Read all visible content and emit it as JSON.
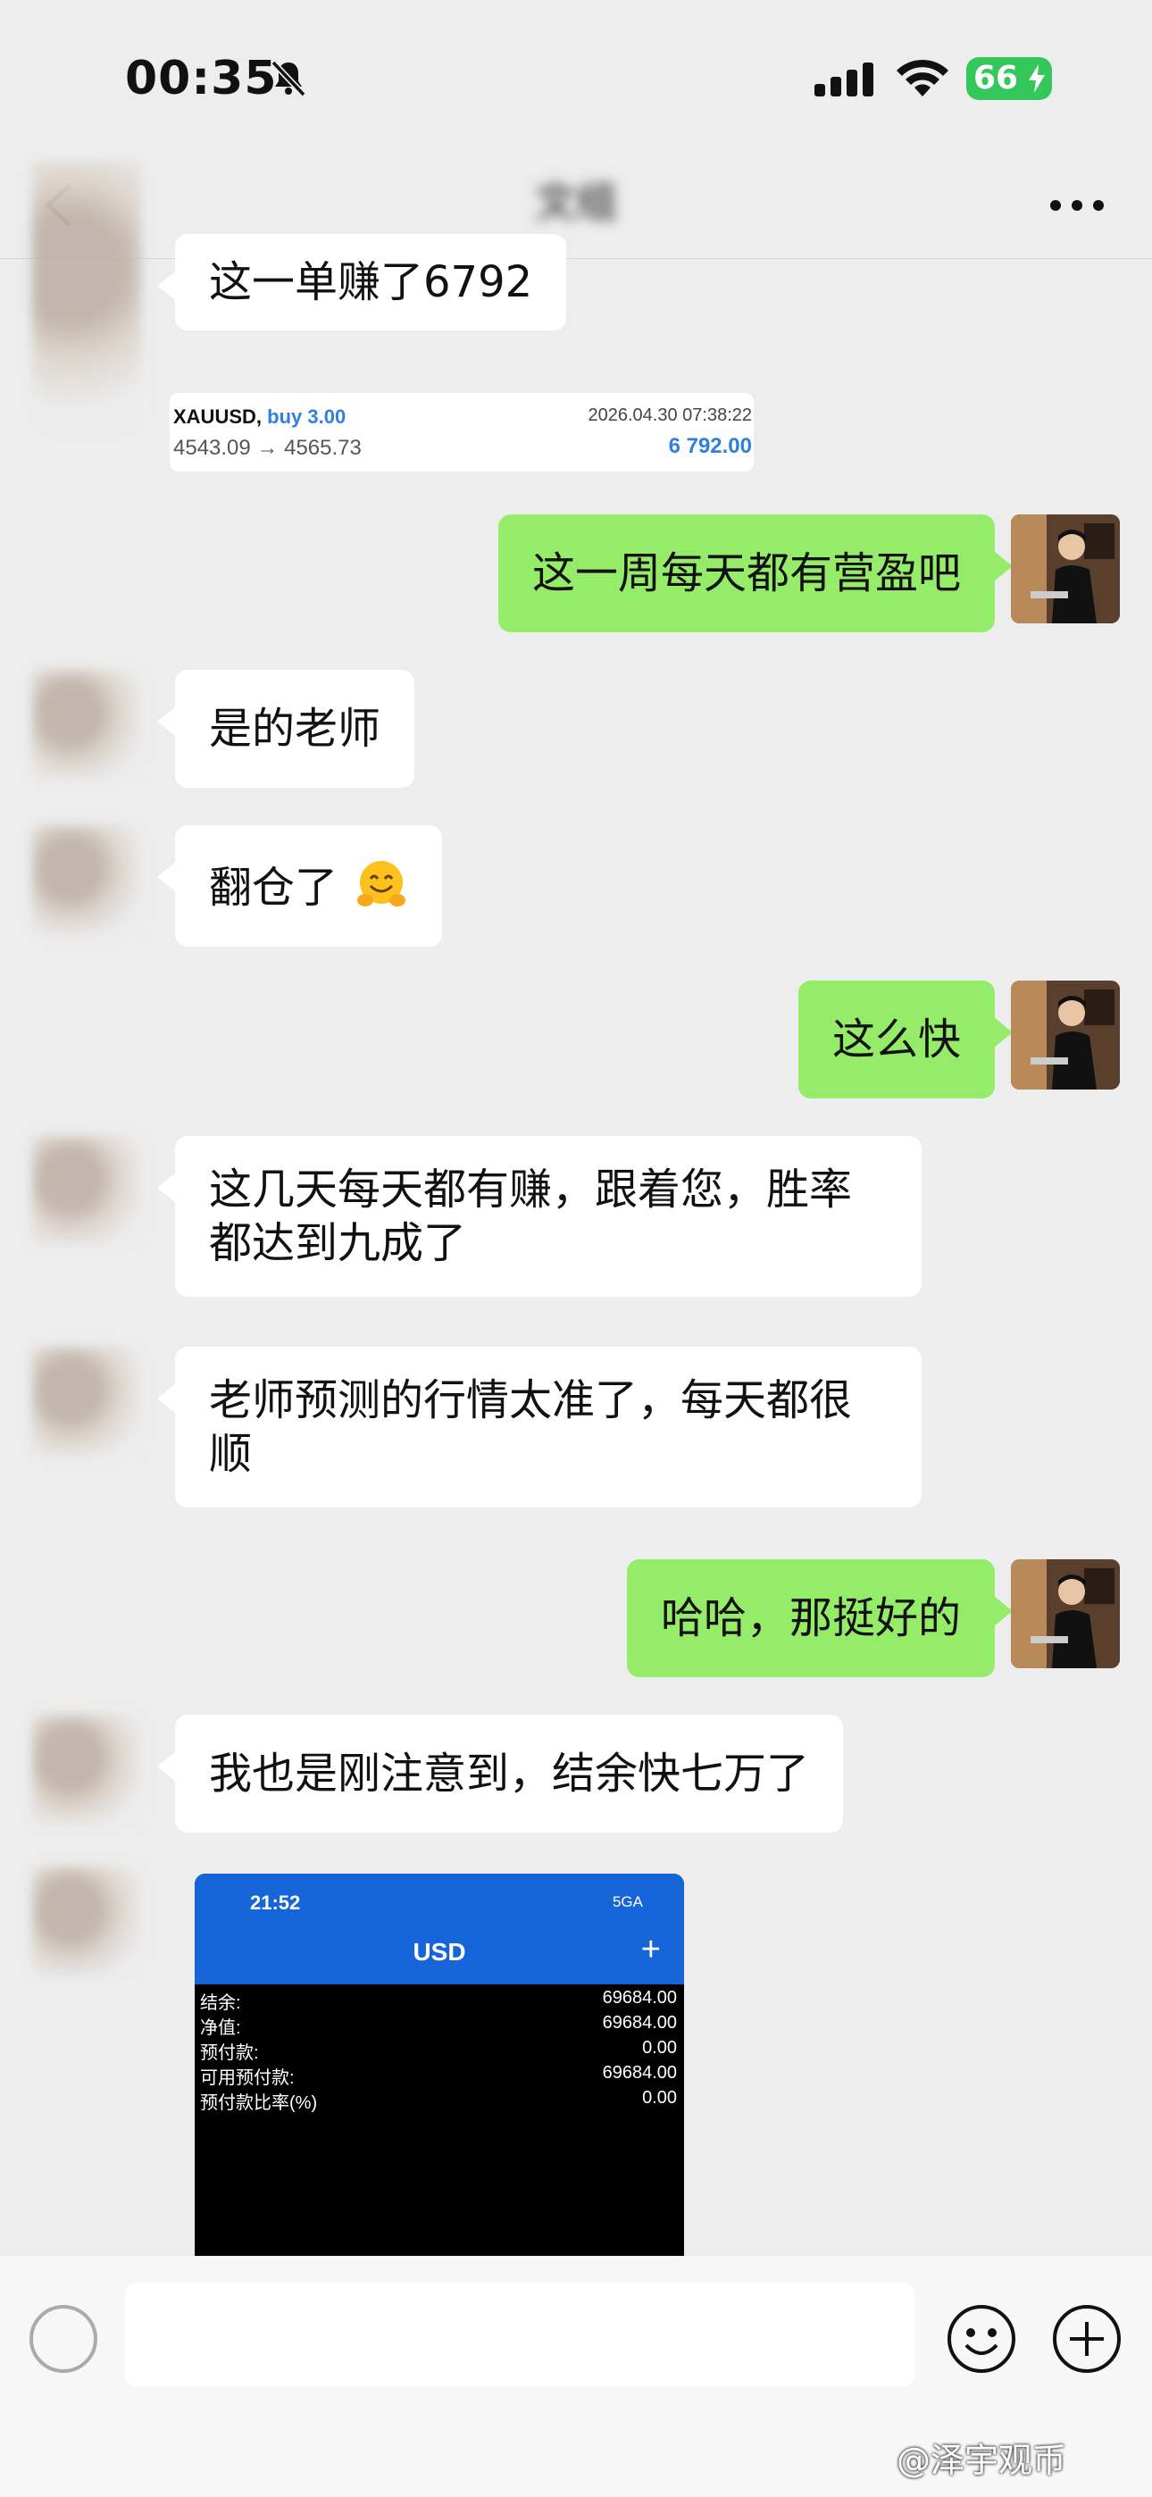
{
  "status_bar": {
    "time": "00:35",
    "battery": "66"
  },
  "nav": {
    "title": "文组"
  },
  "trade_card": {
    "symbol": "XAUUSD,",
    "side": "buy 3.00",
    "prices": "4543.09 → 4565.73",
    "date": "2026.04.30 07:38:22",
    "profit": "6 792.00"
  },
  "messages": [
    {
      "side": "in",
      "text": "这一单赚了6792"
    },
    {
      "side": "out",
      "text": "这一周每天都有营盈吧"
    },
    {
      "side": "in",
      "text": "是的老师"
    },
    {
      "side": "in",
      "text": "翻仓了"
    },
    {
      "side": "out",
      "text": "这么快"
    },
    {
      "side": "in",
      "line1": "这几天每天都有赚，跟着您，胜率",
      "line2": "都达到九成了"
    },
    {
      "side": "in",
      "line1": "老师预测的行情太准了，每天都很",
      "line2": "顺"
    },
    {
      "side": "out",
      "text": "哈哈，那挺好的"
    },
    {
      "side": "in",
      "text": "我也是刚注意到，结余快七万了"
    }
  ],
  "screenshot": {
    "time": "21:52",
    "network": "5GA",
    "title": "USD",
    "rows": [
      {
        "label": "结余:",
        "value": "69684.00"
      },
      {
        "label": "净值:",
        "value": "69684.00"
      },
      {
        "label": "预付款:",
        "value": "0.00"
      },
      {
        "label": "可用预付款:",
        "value": "69684.00"
      },
      {
        "label": "预付款比率(%)",
        "value": "0.00"
      }
    ]
  },
  "input": {
    "placeholder": ""
  },
  "watermark": "@泽宇观币"
}
